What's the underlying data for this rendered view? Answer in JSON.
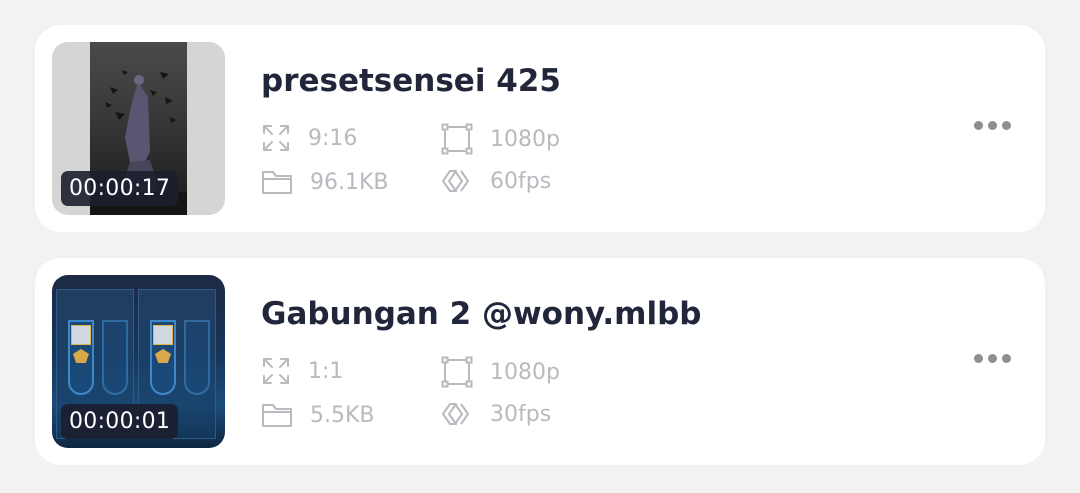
{
  "videos": [
    {
      "duration": "00:00:17",
      "title": "presetsensei 425",
      "aspect_ratio": "9:16",
      "resolution": "1080p",
      "size": "96.1KB",
      "fps": "60fps"
    },
    {
      "duration": "00:00:01",
      "title": "Gabungan 2 @wony.mlbb",
      "aspect_ratio": "1:1",
      "resolution": "1080p",
      "size": "5.5KB",
      "fps": "30fps"
    }
  ],
  "icons": {
    "aspect": "expand-arrows-icon",
    "resolution": "crop-square-icon",
    "size": "folder-icon",
    "fps": "chevrons-right-icon",
    "more": "more-horizontal-icon"
  },
  "colors": {
    "background": "#f2f2f2",
    "card": "#ffffff",
    "title": "#22263a",
    "meta": "#b9b9bf",
    "duration_bg": "#1c1e2e"
  }
}
